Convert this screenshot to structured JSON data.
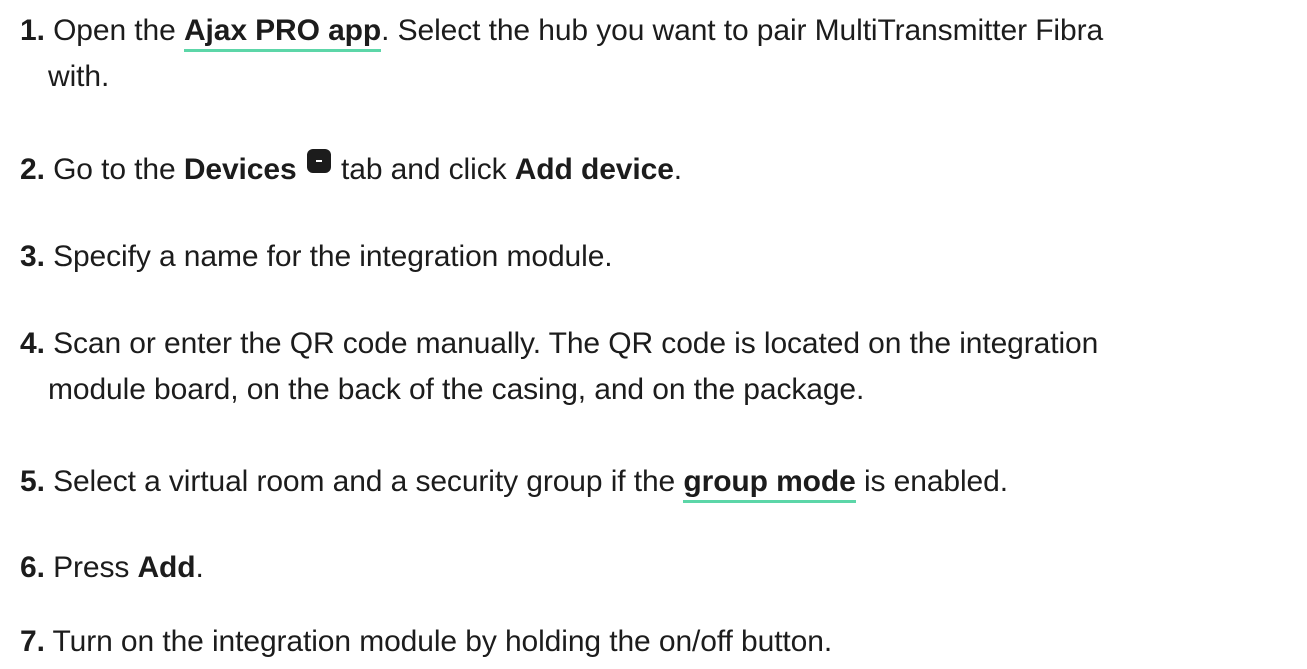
{
  "steps": [
    {
      "num": "1.",
      "t1": " Open the ",
      "link": "Ajax PRO app",
      "t2": ". Select the hub you want to pair MultiTransmitter Fibra",
      "t3": "with."
    },
    {
      "num": "2.",
      "t1": " Go to the ",
      "b1": "Devices",
      "t2": " tab and click ",
      "b2": "Add device",
      "t3": "."
    },
    {
      "num": "3.",
      "t1": " Specify a name for the integration module."
    },
    {
      "num": "4.",
      "t1": " Scan or enter the QR code manually. The QR code is located on the integration",
      "t2": "module board, on the back of the casing, and on the package."
    },
    {
      "num": "5.",
      "t1": " Select a virtual room and a security group if the ",
      "link": "group mode",
      "t2": " is enabled."
    },
    {
      "num": "6.",
      "t1": " Press ",
      "b1": "Add",
      "t2": "."
    },
    {
      "num": "7.",
      "t1": " Turn on the integration module by holding the on/off button."
    }
  ],
  "colors": {
    "text": "#1c1c1c",
    "link_underline": "#5cd6a8"
  },
  "icons": {
    "devices_tab": "devices-tab-icon"
  }
}
